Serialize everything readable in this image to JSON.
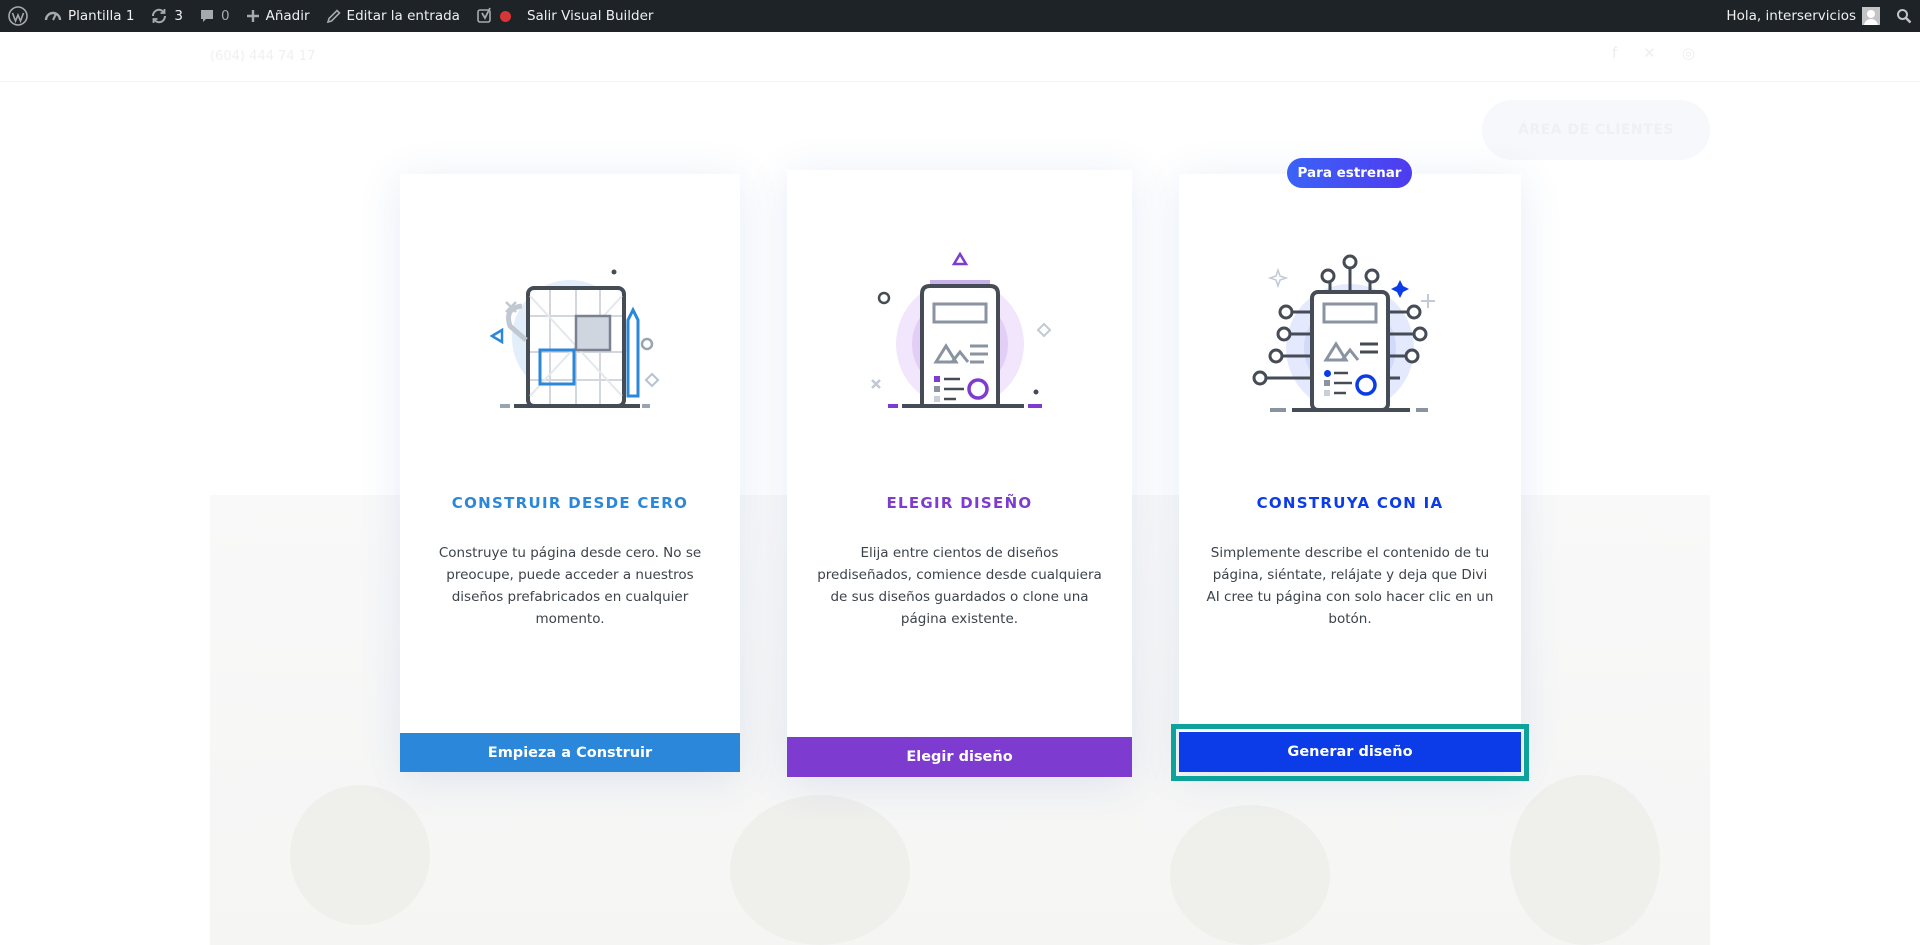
{
  "adminbar": {
    "site_name": "Plantilla 1",
    "updates_count": "3",
    "comments_count": "0",
    "add_label": "Añadir",
    "edit_label": "Editar la entrada",
    "exit_builder_label": "Salir Visual Builder",
    "greeting": "Hola, interservicios",
    "icons": [
      "wordpress-icon",
      "dashboard-icon",
      "refresh-icon",
      "comment-icon",
      "plus-icon",
      "pencil-icon",
      "yoast-icon",
      "record-dot-icon",
      "avatar",
      "search-icon"
    ]
  },
  "page_bg": {
    "phone": "(604) 444 74 17",
    "client_button": "ÁREA DE CLIENTES",
    "social_icons": [
      "facebook-icon",
      "x-icon",
      "instagram-icon"
    ]
  },
  "cards": [
    {
      "title": "CONSTRUIR DESDE CERO",
      "description": "Construye tu página desde cero. No se preocupe, puede acceder a nuestros diseños prefabricados en cualquier momento.",
      "button": "Empieza a Construir",
      "accent": "#2b87da",
      "illustration": "wireframe-illustration"
    },
    {
      "title": "ELEGIR DISEÑO",
      "description": "Elija entre cientos de diseños prediseñados, comience desde cualquiera de sus diseños guardados o clone una página existente.",
      "button": "Elegir diseño",
      "accent": "#7d3bcf",
      "illustration": "layout-illustration"
    },
    {
      "title": "CONSTRUYA CON IA",
      "description": "Simplemente describe el contenido de tu página, siéntate, relájate y deja que Divi AI cree tu página con solo hacer clic en un botón.",
      "button": "Generar diseño",
      "accent": "#0c3be8",
      "badge": "Para estrenar",
      "illustration": "ai-circuit-illustration"
    }
  ]
}
